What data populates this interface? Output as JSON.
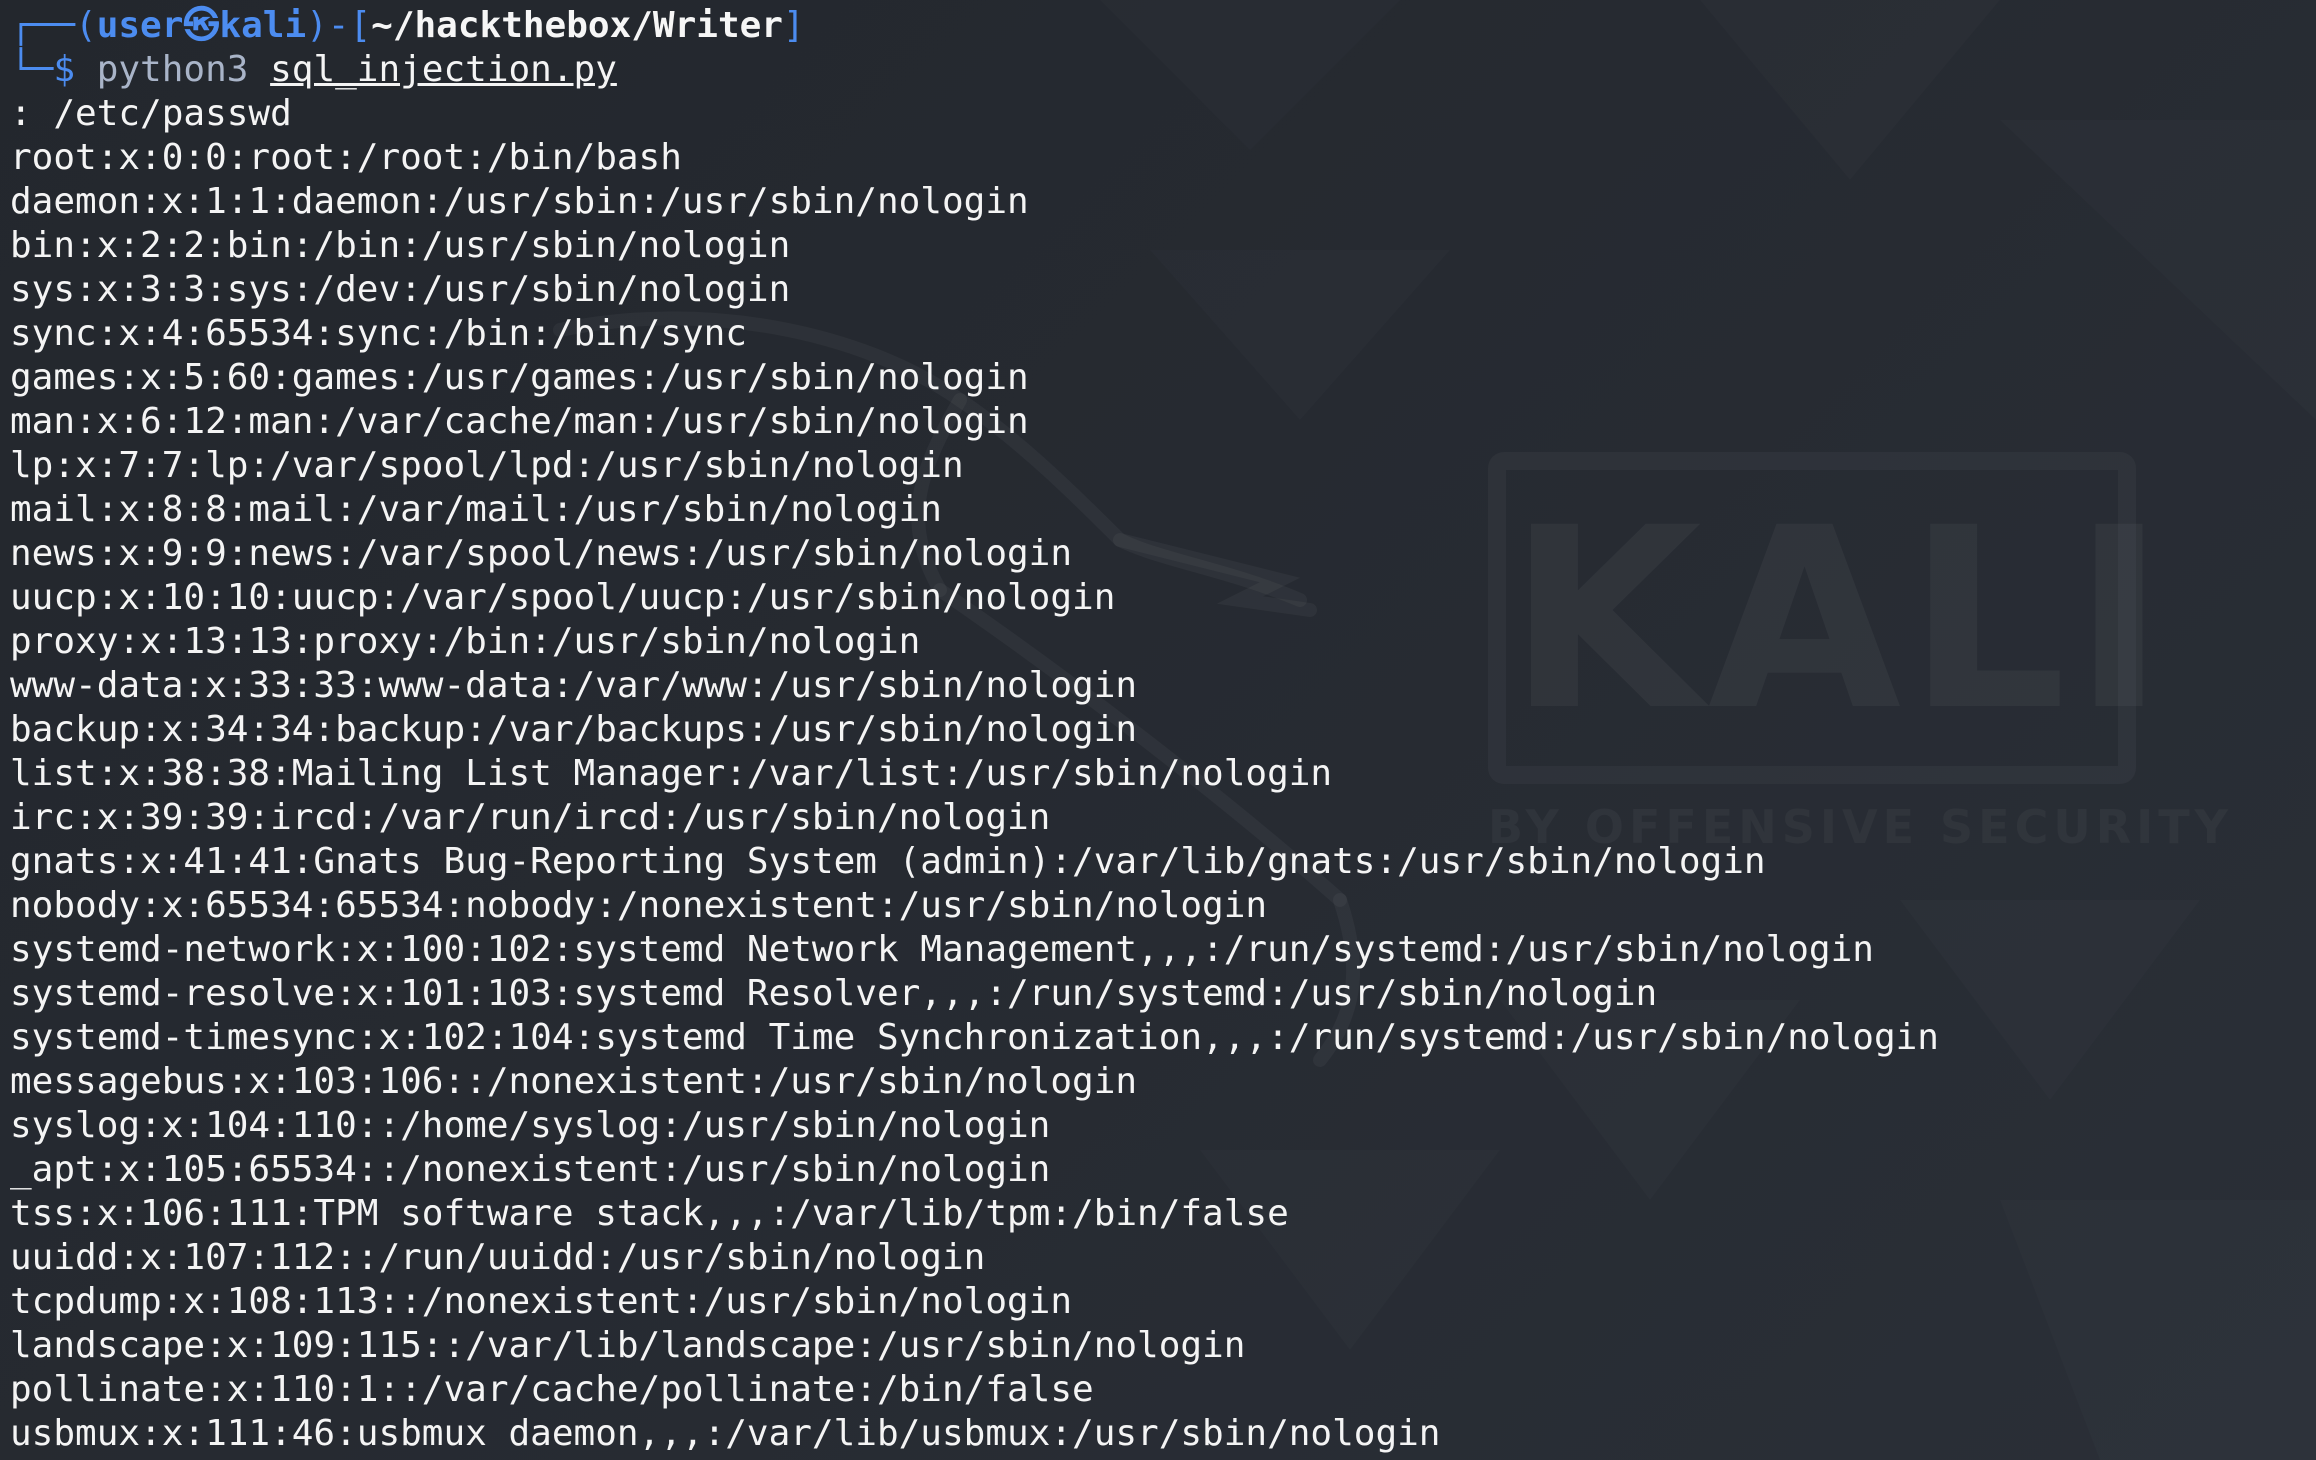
{
  "window": {
    "wallpaper_text": "KALI",
    "wallpaper_tagline": "BY OFFENSIVE SECURITY"
  },
  "prompt": {
    "top_left": "┌──(",
    "user": "user",
    "at_symbol": "㉿",
    "host": "kali",
    "mid": ")-[",
    "path": "~/hackthebox/Writer",
    "close": "]",
    "bottom_left": "└─$ ",
    "command": "python3 ",
    "argument": "sql_injection.py"
  },
  "input_line": ": /etc/passwd",
  "output_lines": [
    "root:x:0:0:root:/root:/bin/bash",
    "daemon:x:1:1:daemon:/usr/sbin:/usr/sbin/nologin",
    "bin:x:2:2:bin:/bin:/usr/sbin/nologin",
    "sys:x:3:3:sys:/dev:/usr/sbin/nologin",
    "sync:x:4:65534:sync:/bin:/bin/sync",
    "games:x:5:60:games:/usr/games:/usr/sbin/nologin",
    "man:x:6:12:man:/var/cache/man:/usr/sbin/nologin",
    "lp:x:7:7:lp:/var/spool/lpd:/usr/sbin/nologin",
    "mail:x:8:8:mail:/var/mail:/usr/sbin/nologin",
    "news:x:9:9:news:/var/spool/news:/usr/sbin/nologin",
    "uucp:x:10:10:uucp:/var/spool/uucp:/usr/sbin/nologin",
    "proxy:x:13:13:proxy:/bin:/usr/sbin/nologin",
    "www-data:x:33:33:www-data:/var/www:/usr/sbin/nologin",
    "backup:x:34:34:backup:/var/backups:/usr/sbin/nologin",
    "list:x:38:38:Mailing List Manager:/var/list:/usr/sbin/nologin",
    "irc:x:39:39:ircd:/var/run/ircd:/usr/sbin/nologin",
    "gnats:x:41:41:Gnats Bug-Reporting System (admin):/var/lib/gnats:/usr/sbin/nologin",
    "nobody:x:65534:65534:nobody:/nonexistent:/usr/sbin/nologin",
    "systemd-network:x:100:102:systemd Network Management,,,:/run/systemd:/usr/sbin/nologin",
    "systemd-resolve:x:101:103:systemd Resolver,,,:/run/systemd:/usr/sbin/nologin",
    "systemd-timesync:x:102:104:systemd Time Synchronization,,,:/run/systemd:/usr/sbin/nologin",
    "messagebus:x:103:106::/nonexistent:/usr/sbin/nologin",
    "syslog:x:104:110::/home/syslog:/usr/sbin/nologin",
    "_apt:x:105:65534::/nonexistent:/usr/sbin/nologin",
    "tss:x:106:111:TPM software stack,,,:/var/lib/tpm:/bin/false",
    "uuidd:x:107:112::/run/uuidd:/usr/sbin/nologin",
    "tcpdump:x:108:113::/nonexistent:/usr/sbin/nologin",
    "landscape:x:109:115::/var/lib/landscape:/usr/sbin/nologin",
    "pollinate:x:110:1::/var/cache/pollinate:/bin/false",
    "usbmux:x:111:46:usbmux daemon,,,:/var/lib/usbmux:/usr/sbin/nologin"
  ],
  "colors": {
    "background": "#25292f",
    "prompt_blue": "#4c8cf0",
    "text": "#f4f4f4"
  }
}
